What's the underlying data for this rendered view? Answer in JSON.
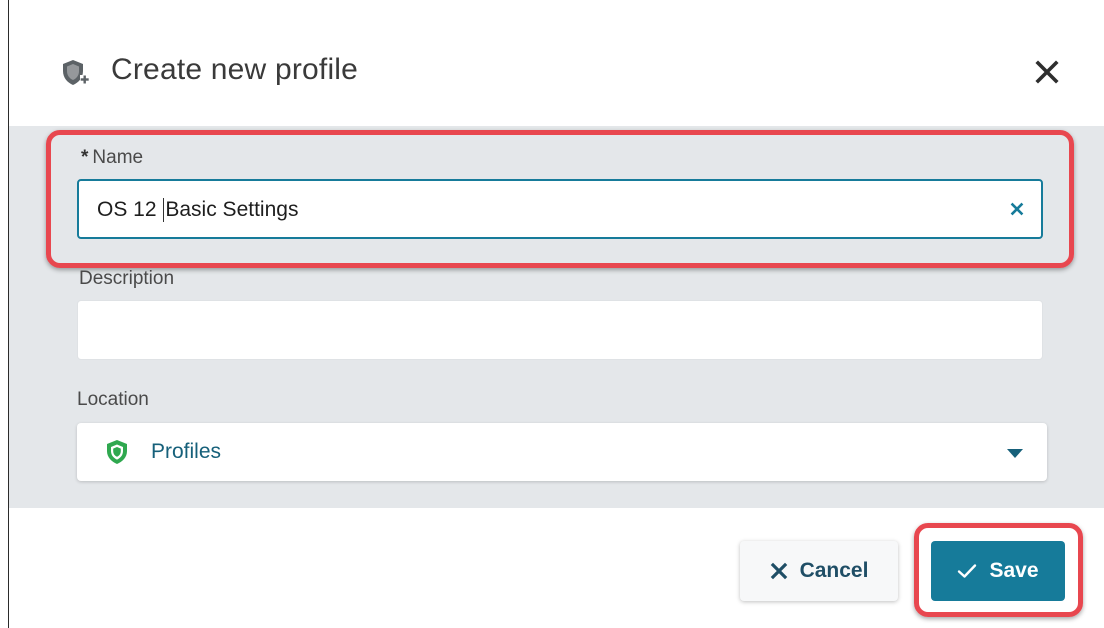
{
  "dialog": {
    "title": "Create new profile",
    "title_icon": "shield-plus-icon",
    "close_icon": "close-icon"
  },
  "form": {
    "name": {
      "required_marker": "*",
      "label": "Name",
      "value_before_caret": "OS 12 ",
      "value_after_caret": "Basic Settings",
      "clear_icon": "clear-icon"
    },
    "description": {
      "label": "Description",
      "value": ""
    },
    "location": {
      "label": "Location",
      "selected": "Profiles",
      "icon": "green-shield-icon",
      "dropdown_icon": "caret-down-icon"
    }
  },
  "buttons": {
    "cancel_label": "Cancel",
    "cancel_icon": "x-icon",
    "save_label": "Save",
    "save_icon": "checkmark-icon"
  },
  "colors": {
    "accent": "#167b9a",
    "highlight": "#e8474f",
    "body_bg": "#e4e7ea",
    "location_shield": "#2fa84f"
  }
}
